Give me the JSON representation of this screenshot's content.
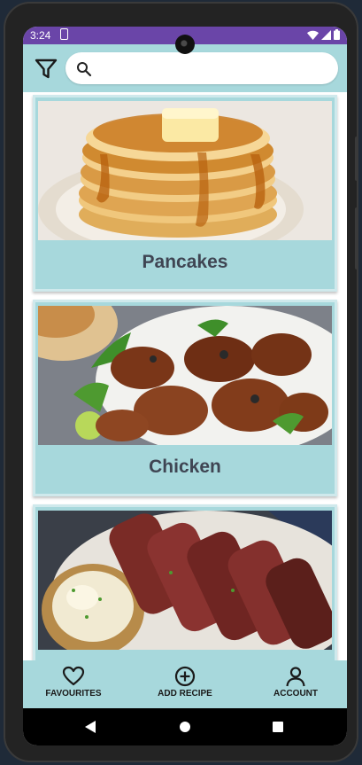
{
  "status_bar": {
    "time": "3:24"
  },
  "search": {
    "placeholder": ""
  },
  "recipes": [
    {
      "title": "Pancakes",
      "image": "pancakes-photo"
    },
    {
      "title": "Chicken",
      "image": "grilled-chicken-photo"
    },
    {
      "title": "",
      "image": "steak-photo"
    }
  ],
  "bottom_nav": {
    "favourites": "FAVOURITES",
    "add_recipe": "ADD RECIPE",
    "account": "ACCOUNT"
  },
  "colors": {
    "status_bar": "#6a45a8",
    "accent": "#a7d8dc",
    "card_title": "#3f4553"
  }
}
